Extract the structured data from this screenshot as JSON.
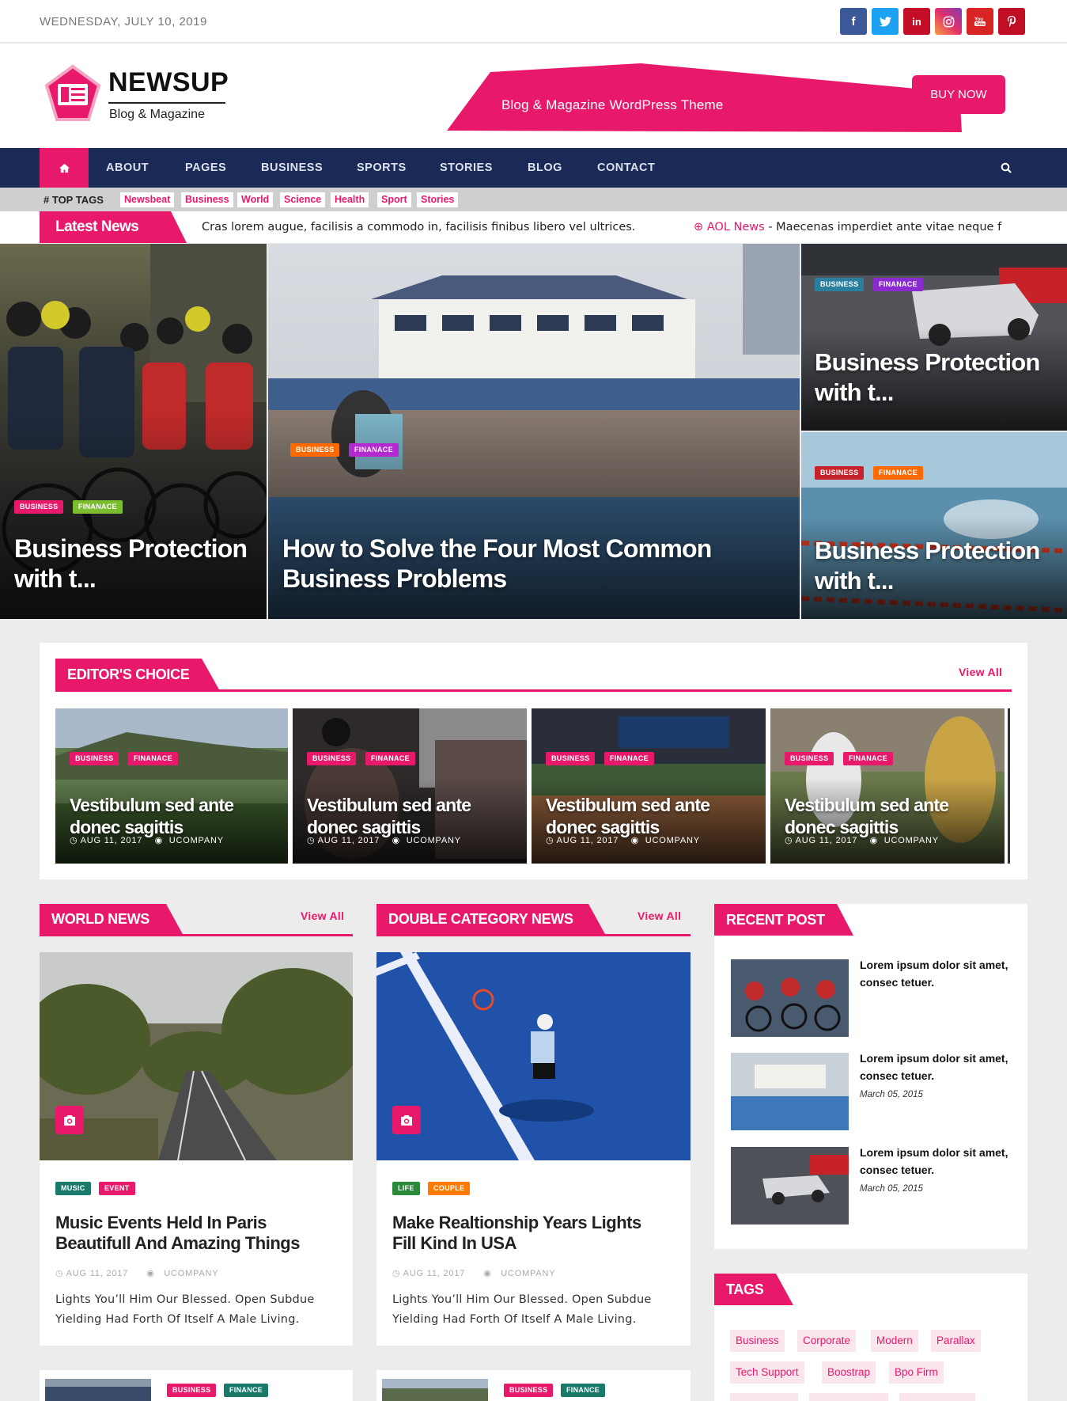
{
  "topbar": {
    "date": "WEDNESDAY, JULY 10, 2019",
    "social": [
      {
        "icon": "facebook-icon",
        "glyph": "f",
        "color": "#3b5998"
      },
      {
        "icon": "twitter-icon",
        "glyph": "t",
        "color": "#1da1f2"
      },
      {
        "icon": "linkedin-icon",
        "glyph": "in",
        "color": "#c40d26"
      },
      {
        "icon": "instagram-icon",
        "glyph": "◎",
        "color": "#e95950"
      },
      {
        "icon": "youtube-icon",
        "glyph": "▶",
        "color": "#d82524"
      },
      {
        "icon": "pinterest-icon",
        "glyph": "P",
        "color": "#c00f24"
      }
    ]
  },
  "header": {
    "logo_name": "NEWSUP",
    "logo_tag": "Blog & Magazine",
    "banner_text": "Blog & Magazine WordPress Theme",
    "buy": "BUY NOW"
  },
  "nav": {
    "home_icon": "home-icon",
    "items": [
      "ABOUT",
      "PAGES",
      "BUSINESS",
      "SPORTS",
      "STORIES",
      "BLOG",
      "CONTACT"
    ],
    "search_icon": "search-icon"
  },
  "toptags": {
    "label": "TOP TAGS",
    "tags": [
      "Newsbeat",
      "Business",
      "World",
      "Science",
      "Health",
      "Sport",
      "Stories"
    ]
  },
  "ticker": {
    "label": "Latest News",
    "item1": "Cras lorem augue, facilisis a commodo in, facilisis finibus libero vel ultrices.",
    "item2_source": "AOL News",
    "item2_text": " - Maecenas imperdiet ante vitae neque f"
  },
  "hero": {
    "left": {
      "badges": [
        "BUSINESS",
        "FINANACE"
      ],
      "title": "Business Protection with t..."
    },
    "center": {
      "badges": [
        "BUSINESS",
        "FINANACE"
      ],
      "title": "How to Solve the Four Most Common Business Problems"
    },
    "right_top": {
      "badges": [
        "BUSINESS",
        "FINANACE"
      ],
      "title": "Business Protection with t..."
    },
    "right_bottom": {
      "badges": [
        "BUSINESS",
        "FINANACE"
      ],
      "title": "Business Protection with t..."
    }
  },
  "editors": {
    "title": "EDITOR'S CHOICE",
    "view_all": "View All",
    "cards": [
      {
        "badges": [
          "BUSINESS",
          "FINANACE"
        ],
        "title": "Vestibulum sed ante donec sagittis",
        "date": "AUG 11, 2017",
        "author": "UCOMPANY"
      },
      {
        "badges": [
          "BUSINESS",
          "FINANACE"
        ],
        "title": "Vestibulum sed ante donec sagittis",
        "date": "AUG 11, 2017",
        "author": "UCOMPANY"
      },
      {
        "badges": [
          "BUSINESS",
          "FINANACE"
        ],
        "title": "Vestibulum sed ante donec sagittis",
        "date": "AUG 11, 2017",
        "author": "UCOMPANY"
      },
      {
        "badges": [
          "BUSINESS",
          "FINANACE"
        ],
        "title": "Vestibulum sed ante donec sagittis",
        "date": "AUG 11, 2017",
        "author": "UCOMPANY"
      }
    ]
  },
  "world": {
    "title": "WORLD NEWS",
    "view_all": "View All",
    "badges": [
      "MUSIC",
      "EVENT"
    ],
    "post_title": "Music Events Held In Paris Beautifull And Amazing Things",
    "date": "AUG 11, 2017",
    "author": "UCOMPANY",
    "desc": "Lights You’ll Him Our Blessed. Open Subdue Yielding Had Forth Of Itself A Male Living.",
    "next_badges": [
      "BUSINESS",
      "FINANCE"
    ]
  },
  "double": {
    "title": "DOUBLE CATEGORY NEWS",
    "view_all": "View All",
    "badges": [
      "LIFE",
      "COUPLE"
    ],
    "post_title": "Make Realtionship Years Lights Fill Kind In USA",
    "date": "AUG 11, 2017",
    "author": "UCOMPANY",
    "desc": "Lights You’ll Him Our Blessed. Open Subdue Yielding Had Forth Of Itself A Male Living.",
    "next_badges": [
      "BUSINESS",
      "FINANCE"
    ]
  },
  "recent": {
    "title": "RECENT POST",
    "posts": [
      {
        "text": "Lorem ipsum dolor sit amet, consec tetuer.",
        "date": ""
      },
      {
        "text": "Lorem ipsum dolor sit amet, consec tetuer.",
        "date": "March 05, 2015"
      },
      {
        "text": "Lorem ipsum dolor sit amet, consec tetuer.",
        "date": "March 05, 2015"
      }
    ]
  },
  "tags": {
    "title": "TAGS",
    "items": [
      "Business",
      "Corporate",
      "Modern",
      "Parallax",
      "Tech Support",
      "Boostrap",
      "Bpo Firm"
    ]
  },
  "colors": {
    "accent": "#e8196a",
    "nav": "#1a2955",
    "business": "#e8196a",
    "finance_green": "#7bbd2c",
    "finance_purple": "#b22ad0",
    "finance_orange": "#ff6a00",
    "business_teal": "#2a7f9e"
  }
}
